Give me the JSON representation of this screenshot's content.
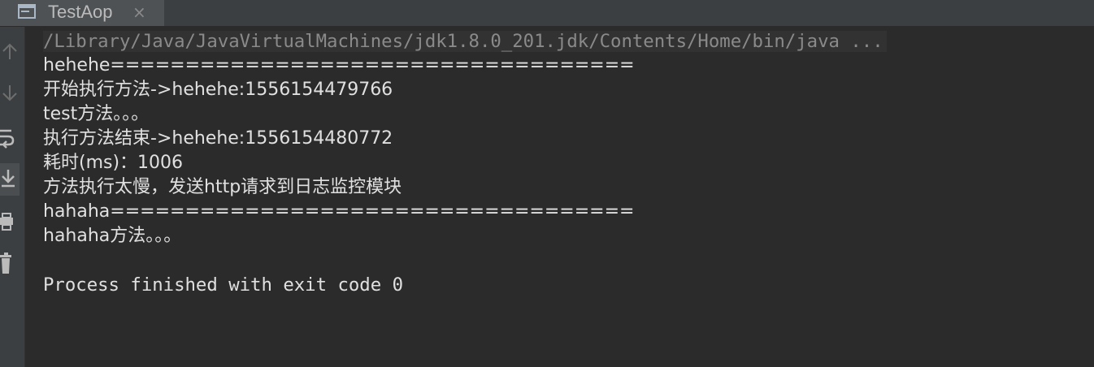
{
  "tab": {
    "label": "TestAop",
    "close_glyph": "×",
    "icon": "console-window-icon"
  },
  "sidebar": {
    "buttons": [
      {
        "name": "scroll-up-icon"
      },
      {
        "name": "scroll-down-icon"
      },
      {
        "name": "soft-wrap-icon"
      },
      {
        "name": "scroll-to-end-icon"
      },
      {
        "name": "print-icon"
      },
      {
        "name": "clear-all-icon"
      }
    ]
  },
  "console": {
    "command_line": "/Library/Java/JavaVirtualMachines/jdk1.8.0_201.jdk/Contents/Home/bin/java ...",
    "lines": [
      "hehehe===================================",
      "开始执行方法->hehehe:1556154479766",
      "test方法。。。",
      "执行方法结束->hehehe:1556154480772",
      "耗时(ms)：1006",
      "方法执行太慢，发送http请求到日志监控模块",
      "hahaha===================================",
      "hahaha方法。。。",
      "",
      "Process finished with exit code 0"
    ]
  },
  "colors": {
    "background": "#2b2b2b",
    "toolbar": "#3c3f41",
    "output_text": "#e0e0e0",
    "command_text": "#8a8a8a"
  }
}
